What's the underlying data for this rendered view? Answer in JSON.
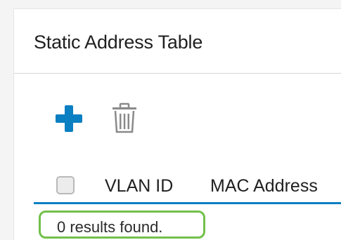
{
  "panel": {
    "title": "Static Address Table"
  },
  "toolbar": {
    "add_icon": "plus-icon",
    "delete_icon": "trash-icon"
  },
  "table": {
    "columns": [
      "VLAN ID",
      "MAC Address"
    ]
  },
  "results": {
    "text": "0 results found."
  },
  "colors": {
    "accent_blue": "#0a7fc2",
    "highlight_green": "#72c04a",
    "icon_gray": "#8a8a8a"
  }
}
